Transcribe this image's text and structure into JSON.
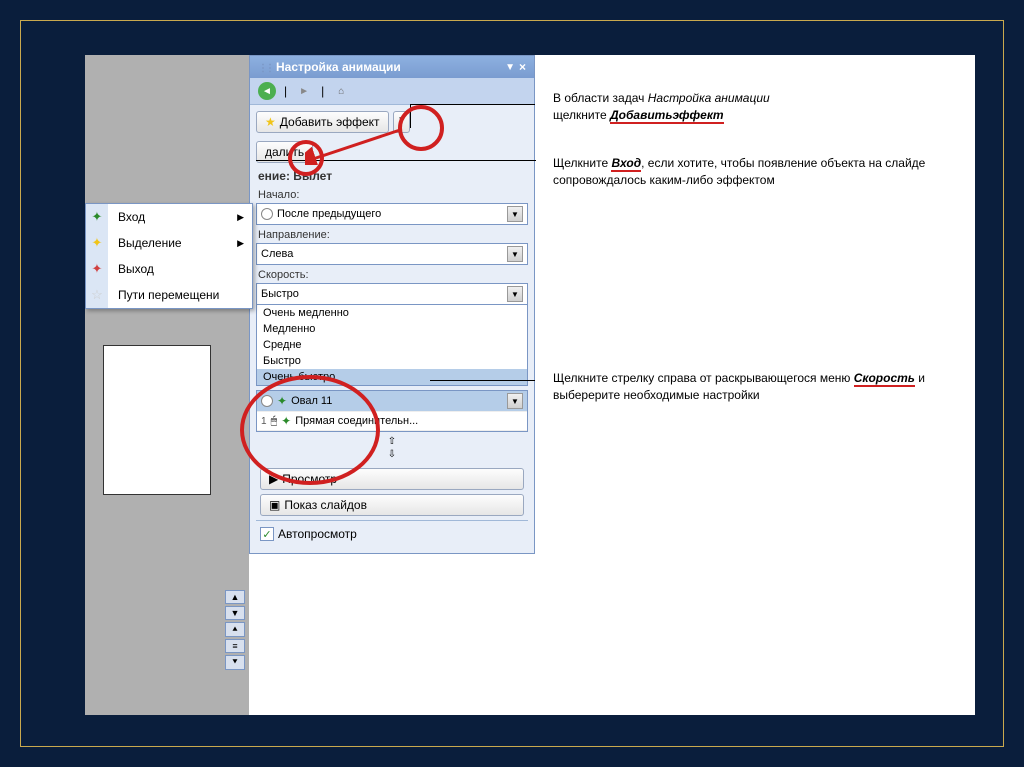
{
  "taskpane": {
    "title": "Настройка анимации",
    "add_effect_label": "Добавить эффект",
    "remove_label": "далить",
    "section_heading": "ение: Вылет",
    "start_label": "Начало:",
    "start_value": "После предыдущего",
    "direction_label": "Направление:",
    "direction_value": "Слева",
    "speed_label": "Скорость:",
    "speed_value": "Быстро",
    "speed_options": [
      "Очень медленно",
      "Медленно",
      "Средне",
      "Быстро",
      "Очень быстро"
    ],
    "anim_items": [
      {
        "label": "Овал 11"
      },
      {
        "num": "1",
        "label": "Прямая соединительн..."
      }
    ],
    "preview_label": "Просмотр",
    "slideshow_label": "Показ слайдов",
    "autopreview_label": "Автопросмотр"
  },
  "context_menu": {
    "items": [
      {
        "label": "Вход",
        "star": "sg",
        "arrow": true
      },
      {
        "label": "Выделение",
        "star": "sy",
        "arrow": true
      },
      {
        "label": "Выход",
        "star": "sr",
        "arrow": false
      },
      {
        "label": "Пути перемещени",
        "star": "sw",
        "arrow": false
      }
    ]
  },
  "explanations": {
    "e1_a": "В области задач ",
    "e1_b": "Настройка анимации",
    "e1_c": "щелкните ",
    "e1_d": "Добавитьэффект",
    "e2_a": "Щелкните ",
    "e2_b": "Вход",
    "e2_c": ", если хотите, чтобы появление объекта на слайде сопровождалось каким-либо эффектом",
    "e3_a": "Щелкните стрелку справа от раскрывающегося меню ",
    "e3_b": "Скорость",
    "e3_c": " и выберерите необходимые настройки"
  }
}
